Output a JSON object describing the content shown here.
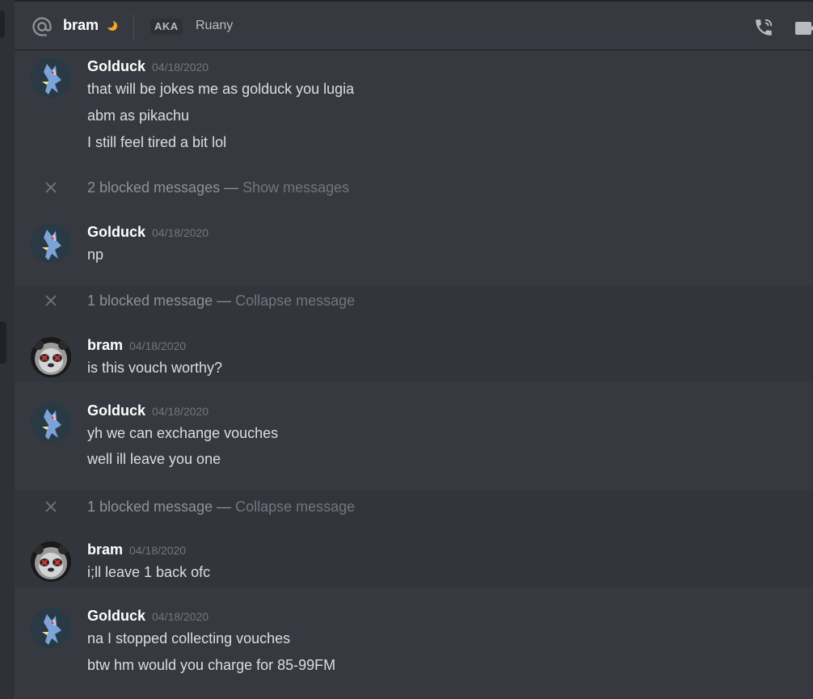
{
  "header": {
    "username": "bram",
    "status": "idle",
    "aka_badge": "AKA",
    "aka_name": "Ruany",
    "icons": [
      "at-icon",
      "moon-icon",
      "phone-call-icon",
      "video-camera-icon"
    ]
  },
  "messages": [
    {
      "author": "Golduck",
      "timestamp": "04/18/2020",
      "lines": [
        "that will be jokes me as  golduck you lugia",
        "abm as pikachu",
        "I still feel tired a bit lol"
      ]
    },
    {
      "blocked_count": "2 blocked messages —",
      "action": "Show messages"
    },
    {
      "author": "Golduck",
      "timestamp": "04/18/2020",
      "lines": [
        "np"
      ]
    },
    {
      "blocked_count": "1 blocked message —",
      "action": "Collapse message"
    },
    {
      "author": "bram",
      "timestamp": "04/18/2020",
      "lines": [
        "is this vouch worthy?"
      ]
    },
    {
      "author": "Golduck",
      "timestamp": "04/18/2020",
      "lines": [
        "yh we can exchange vouches",
        "well ill leave you one"
      ]
    },
    {
      "blocked_count": "1 blocked message —",
      "action": "Collapse message"
    },
    {
      "author": "bram",
      "timestamp": "04/18/2020",
      "lines": [
        "i;ll leave 1 back ofc"
      ]
    },
    {
      "author": "Golduck",
      "timestamp": "04/18/2020",
      "lines": [
        "na I stopped collecting vouches",
        "btw hm would you charge for 85-99FM"
      ]
    }
  ],
  "colors": {
    "background": "#36393f",
    "highlight": "#32353b",
    "text": "#dcddde",
    "muted": "#72767d",
    "idle": "#faa61a"
  }
}
